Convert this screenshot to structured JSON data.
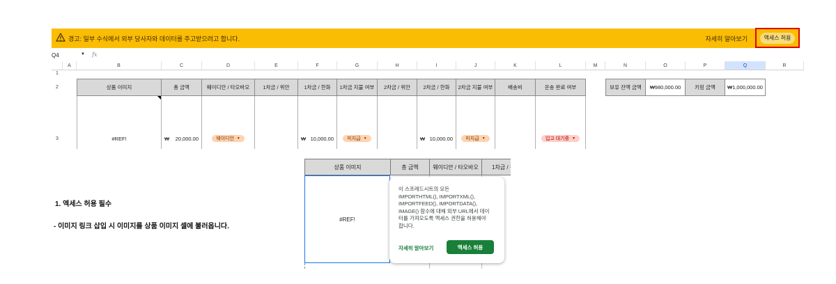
{
  "banner": {
    "message": "경고: 일부 수식에서 외부 당사자와 데이터를 주고받으려고 합니다.",
    "learn_more": "자세히 알아보기",
    "allow_button": "액세스 허용",
    "icon": "warning-icon",
    "color": "#fbbc04"
  },
  "formula_bar": {
    "cell_ref": "Q4",
    "dropdown": "▼",
    "fx": "fx"
  },
  "columns": [
    "A",
    "B",
    "C",
    "D",
    "E",
    "F",
    "G",
    "H",
    "I",
    "J",
    "K",
    "L",
    "M",
    "N",
    "O",
    "P",
    "Q",
    "R"
  ],
  "rows": [
    "1",
    "2",
    "3"
  ],
  "header_row": {
    "b": "상품 이미지",
    "c": "총 금액",
    "d": "웨이디안 / 타오바오",
    "e": "1차금 / 위안",
    "f": "1차금 / 한화",
    "g": "1차금 지불 여부",
    "h": "2차금 / 위안",
    "i": "2차금 / 한화",
    "j": "2차금 지불 여부",
    "k": "배송비",
    "l": "운송 완료 여부"
  },
  "data_row": {
    "b": "#REF!",
    "c_symbol": "₩",
    "c_value": "20,000.00",
    "d_chip": "웨이디안",
    "f_symbol": "₩",
    "f_value": "10,000.00",
    "g_chip": "미지급",
    "i_symbol": "₩",
    "i_value": "10,000.00",
    "j_chip": "미지급",
    "l_chip": "입고 대기중"
  },
  "summary": {
    "balance_label": "보유 잔액 금액",
    "balance_value": "₩980,000.00",
    "keeping_label": "키핑 금액",
    "keeping_value": "₩1,000,000.00"
  },
  "instructions": {
    "line1": "1. 엑세스 허용 필수",
    "line2": "- 이미지 링크 삽입 시 이미지를 상품 이미지 셀에 불러옵니다."
  },
  "inset": {
    "h1": "상품 이미지",
    "h2": "총 금액",
    "h3": "웨이디안 / 타오바오",
    "h4": "1차금 / 위",
    "cell": "#REF!",
    "popup_text": "이 스프레드시트의 모든\nIMPORTHTML(), IMPORTXML(),\nIMPORTFEED(), IMPORTDATA(),\nIMAGE() 함수에 대해 외부 URL에서 데이\n터를 가져오도록 액세스 권한을 허용해야\n합니다.",
    "popup_learn": "자세히 알아보기",
    "popup_button": "액세스 허용",
    "accent": "#188038"
  }
}
